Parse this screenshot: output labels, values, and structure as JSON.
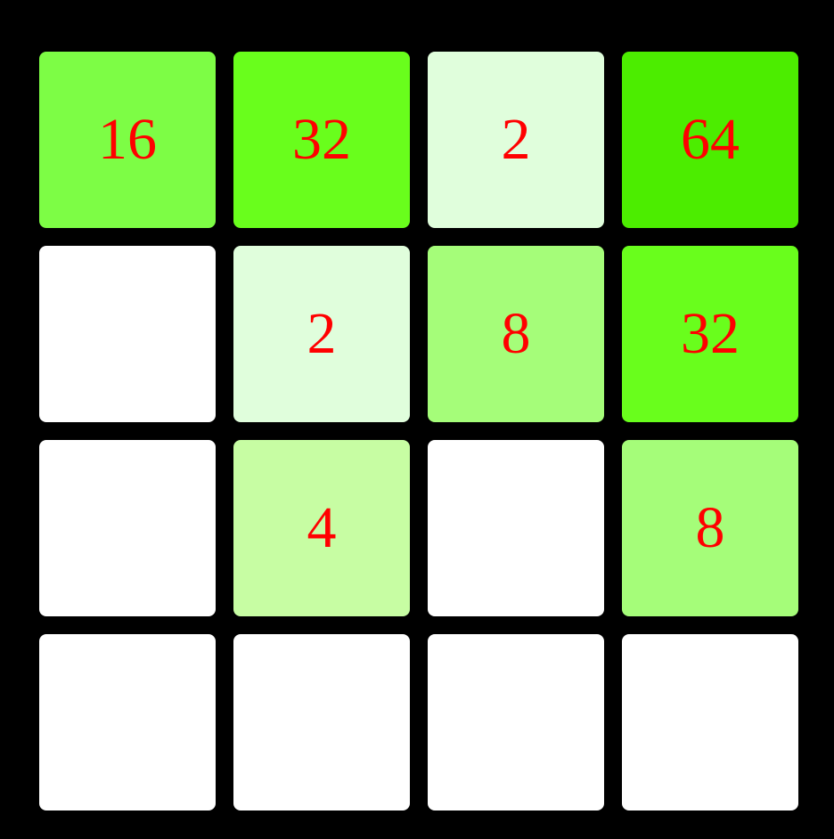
{
  "board": {
    "tiles": [
      {
        "value": "16",
        "color": "#7dfd45"
      },
      {
        "value": "32",
        "color": "#69fe1c"
      },
      {
        "value": "2",
        "color": "#e0fedc"
      },
      {
        "value": "64",
        "color": "#4ced00"
      },
      {
        "value": "",
        "color": "#ffffff"
      },
      {
        "value": "2",
        "color": "#e0fedc"
      },
      {
        "value": "8",
        "color": "#a5fd79"
      },
      {
        "value": "32",
        "color": "#69fe1c"
      },
      {
        "value": "",
        "color": "#ffffff"
      },
      {
        "value": "4",
        "color": "#c7fda3"
      },
      {
        "value": "",
        "color": "#ffffff"
      },
      {
        "value": "8",
        "color": "#a5fd79"
      },
      {
        "value": "",
        "color": "#ffffff"
      },
      {
        "value": "",
        "color": "#ffffff"
      },
      {
        "value": "",
        "color": "#ffffff"
      },
      {
        "value": "",
        "color": "#ffffff"
      }
    ],
    "text_color": "#ff0000",
    "background_color": "#000000"
  }
}
